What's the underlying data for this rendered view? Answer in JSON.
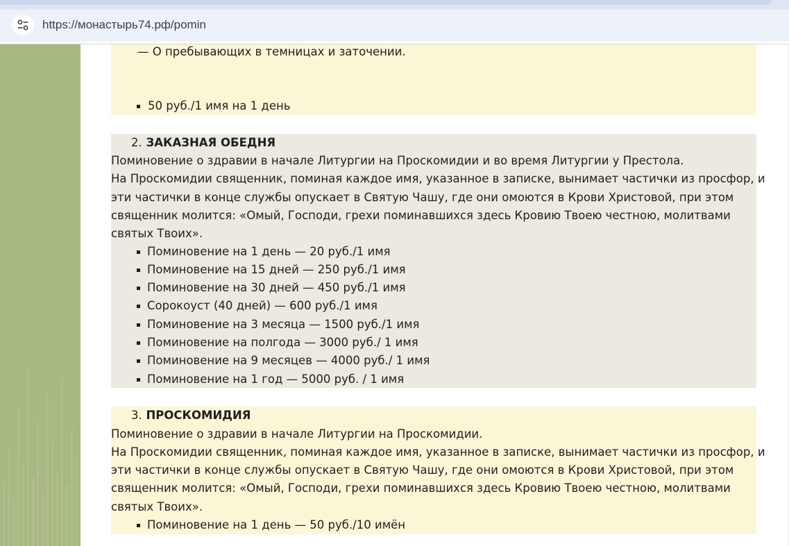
{
  "browser": {
    "url": "https://монастырь74.рф/pomin",
    "site_info_icon": "tune-icon"
  },
  "block1": {
    "dash_line": "— О пребывающих в темницах и заточении.",
    "price": "50 руб./1 имя на 1 день"
  },
  "block2": {
    "number": "2.",
    "title": "ЗАКАЗНАЯ ОБЕДНЯ",
    "intro": "Поминовение о здравии в начале Литургии на Проскомидии и во время Литургии у Престола.",
    "desc_lines": [
      "На Проскомидии священник, поминая каждое имя, указанное в записке, вынимает частички из просфор, и",
      "эти частички в конце службы опускает в Святую Чашу, где они омоются в Крови Христовой, при этом",
      "священник молится: «Омый, Господи, грехи поминавшихся здесь Кровию Твоею честною, молитвами",
      "святых Твоих»."
    ],
    "prices": [
      "Поминовение на 1 день — 20 руб./1 имя",
      "Поминовение на 15 дней — 250 руб./1 имя",
      "Поминовение на 30 дней — 450 руб./1 имя",
      "Сорокоуст (40 дней) — 600 руб./1 имя",
      "Поминовение на 3 месяца — 1500 руб./1 имя",
      "Поминовение на полгода — 3000 руб./ 1 имя",
      "Поминовение на 9 месяцев — 4000 руб./ 1 имя",
      "Поминовение на 1 год — 5000 руб. / 1 имя"
    ]
  },
  "block3": {
    "number": "3.",
    "title": "ПРОСКОМИДИЯ",
    "intro": "Поминовение о здравии в начале Литургии на Проскомидии.",
    "desc_lines": [
      "На Проскомидии священник, поминая каждое имя, указанное в записке, вынимает частички из просфор, и",
      "эти частички в конце службы опускает в Святую Чашу, где они омоются в Крови Христовой, при этом",
      "священник молится: «Омый, Господи, грехи поминавшихся здесь Кровию Твоею честною, молитвами",
      "святых Твоих»."
    ],
    "prices": [
      "Поминовение на 1 день — 50 руб./10 имён"
    ]
  },
  "colors": {
    "sidebar": "#a8b882",
    "block_yellow": "#fbf7d6",
    "block_grey": "#ece9e1",
    "address_bar": "#edf2fa"
  }
}
